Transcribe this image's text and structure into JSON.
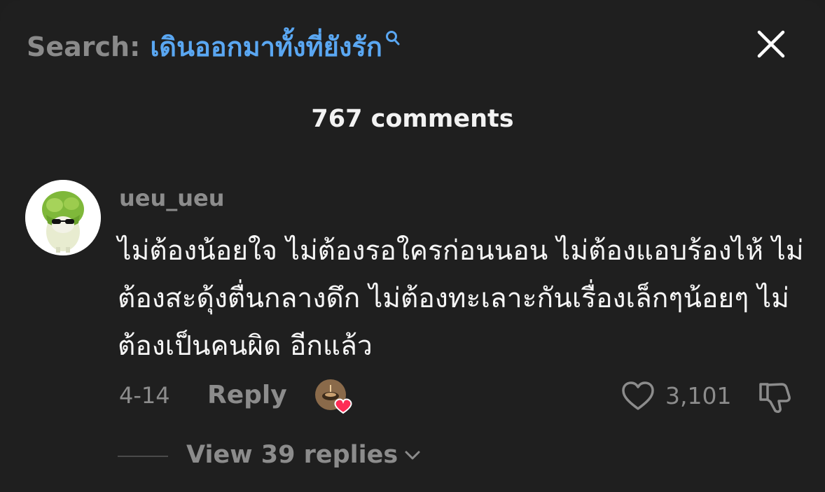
{
  "header": {
    "search_prefix": "Search:",
    "search_query": "เดินออกมาทั้งที่ยังรัก",
    "search_icon": "search-icon",
    "close_icon": "close-icon"
  },
  "comments_count": "767 comments",
  "comment": {
    "username": "ueu_ueu",
    "text": "ไม่ต้องน้อยใจ ไม่ต้องรอใครก่อนนอน ไม่ต้องแอบร้องไห้ ไม่ต้องสะดุ้งตื่นกลางดึก ไม่ต้องทะเลาะกันเรื่องเล็กๆน้อยๆ ไม่ต้องเป็นคนผิด อีกแล้ว",
    "date": "4-14",
    "reply_label": "Reply",
    "like_count": "3,101",
    "view_replies_label": "View 39 replies"
  },
  "colors": {
    "background": "#1f1f1f",
    "query_blue": "#5aa7f2",
    "muted_gray": "#8c8c8c",
    "heart_red": "#fe2c55"
  }
}
